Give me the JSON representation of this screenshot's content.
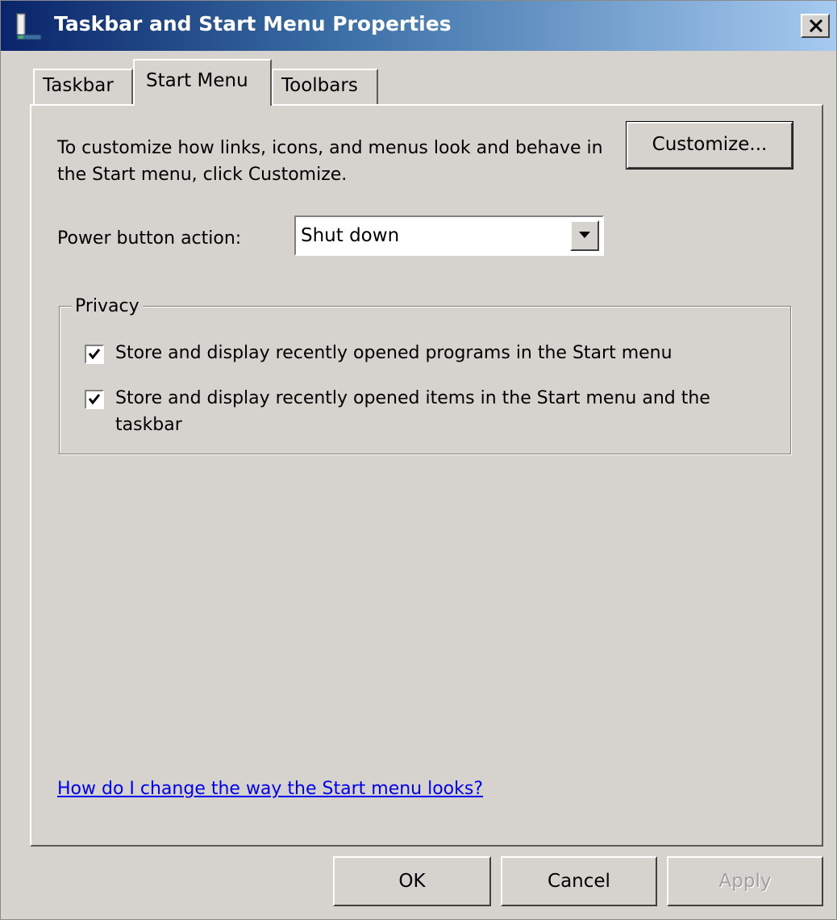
{
  "window": {
    "title": "Taskbar and Start Menu Properties"
  },
  "tabs": [
    {
      "label": "Taskbar"
    },
    {
      "label": "Start Menu",
      "selected": true
    },
    {
      "label": "Toolbars"
    }
  ],
  "start_menu": {
    "description": "To customize how links, icons, and menus look and behave in the Start menu, click Customize.",
    "customize_label": "Customize...",
    "power_label": "Power button action:",
    "power_value": "Shut down"
  },
  "privacy": {
    "legend": "Privacy",
    "items": [
      {
        "label": "Store and display recently opened programs in the Start menu",
        "checked": true
      },
      {
        "label": "Store and display recently opened items in the Start menu and the taskbar",
        "checked": true
      }
    ]
  },
  "help_link": "How do I change the way the Start menu looks?",
  "buttons": {
    "ok": "OK",
    "cancel": "Cancel",
    "apply": "Apply"
  },
  "icons": {
    "window_icon": "taskbar-properties-icon",
    "close": "close-icon",
    "dropdown": "chevron-down-icon",
    "check": "checkmark-icon"
  },
  "colors": {
    "title_bar_start": "#0a246a",
    "title_bar_end": "#a6caf0",
    "dialog_background": "#d6d3ce",
    "link": "#0000ee",
    "disabled_text": "#a0a0a0"
  }
}
